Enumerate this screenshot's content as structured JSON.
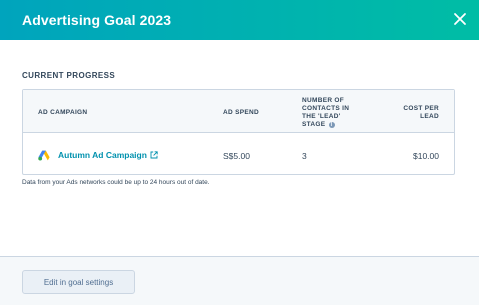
{
  "header": {
    "title": "Advertising Goal 2023",
    "close_icon": "close-icon"
  },
  "progress": {
    "section_label": "CURRENT PROGRESS",
    "columns": {
      "campaign": "AD CAMPAIGN",
      "spend": "AD SPEND",
      "contacts": "NUMBER OF CONTACTS IN THE 'LEAD' STAGE",
      "cost": "COST PER LEAD"
    },
    "rows": [
      {
        "campaign": "Autumn Ad Campaign",
        "spend": "S$5.00",
        "contacts": "3",
        "cost": "$10.00"
      }
    ],
    "disclaimer": "Data from your Ads networks could be up to 24 hours out of date."
  },
  "footer": {
    "edit_label": "Edit in goal settings"
  },
  "colors": {
    "header_start": "#00a4bd",
    "header_end": "#00bda5",
    "link": "#0091ae"
  }
}
